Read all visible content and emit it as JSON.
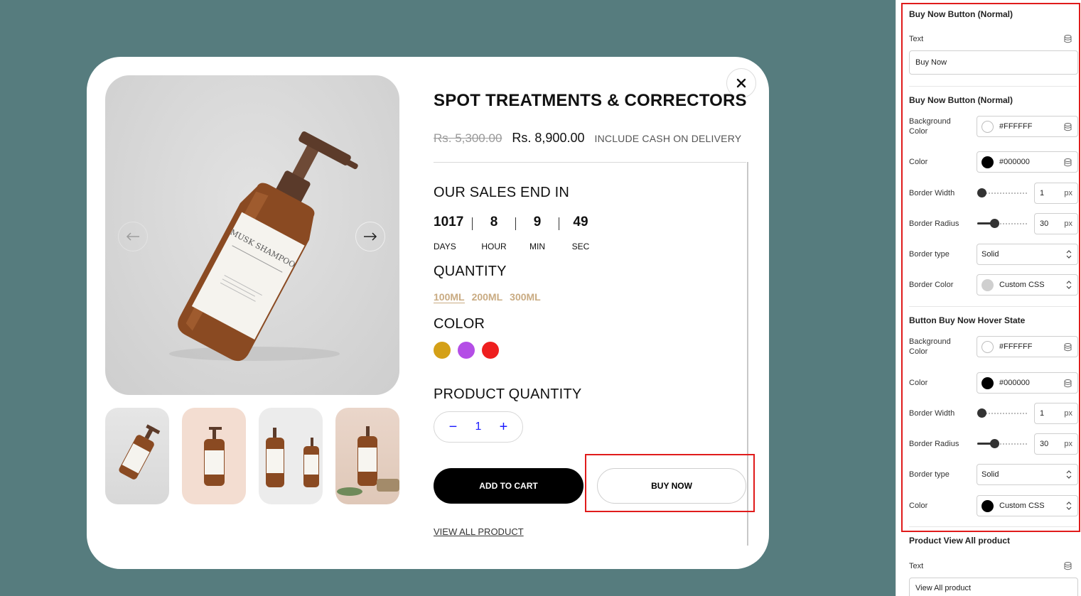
{
  "product": {
    "title": "SPOT TREATMENTS & CORRECTORS",
    "old_price": "Rs. 5,300.00",
    "new_price": "Rs. 8,900.00",
    "cod_note": "INCLUDE CASH ON DELIVERY",
    "image_label": "MUSK SHAMPOO",
    "sales_title": "OUR SALES END IN",
    "countdown": [
      {
        "value": "1017",
        "label": "DAYS"
      },
      {
        "value": "8",
        "label": "HOUR"
      },
      {
        "value": "9",
        "label": "MIN"
      },
      {
        "value": "49",
        "label": "SEC"
      }
    ],
    "quantity_title": "QUANTITY",
    "sizes": [
      "100ML",
      "200ML",
      "300ML"
    ],
    "selected_size": "100ML",
    "color_title": "COLOR",
    "colors": [
      "#d4a017",
      "#b44ee6",
      "#ee1f1f"
    ],
    "product_quantity_title": "PRODUCT QUANTITY",
    "quantity_value": "1",
    "minus_symbol": "−",
    "plus_symbol": "+",
    "add_to_cart_label": "ADD TO CART",
    "buy_now_label": "BUY NOW",
    "view_all_label": "VIEW ALL PRODUCT"
  },
  "panel": {
    "section1_title": "Buy Now Button (Normal)",
    "text_label": "Text",
    "text_value": "Buy Now",
    "section2_title": "Buy Now Button (Normal)",
    "normal": {
      "bg_label_1": "Background",
      "bg_label_2": "Color",
      "bg_value": "#FFFFFF",
      "color_label": "Color",
      "color_value": "#000000",
      "border_width_label": "Border Width",
      "border_width_value": "1",
      "border_radius_label": "Border Radius",
      "border_radius_value": "30",
      "border_type_label": "Border type",
      "border_type_value": "Solid",
      "border_color_label": "Border Color",
      "border_color_value": "Custom CSS",
      "unit": "px"
    },
    "section3_title": "Button Buy Now Hover State",
    "hover": {
      "bg_label_1": "Background",
      "bg_label_2": "Color",
      "bg_value": "#FFFFFF",
      "color_label": "Color",
      "color_value": "#000000",
      "border_width_label": "Border Width",
      "border_width_value": "1",
      "border_radius_label": "Border Radius",
      "border_radius_value": "30",
      "border_type_label": "Border type",
      "border_type_value": "Solid",
      "border_color_label": "Color",
      "border_color_value": "Custom CSS",
      "unit": "px"
    },
    "section4_title": "Product View All product",
    "view_all_text_label": "Text",
    "view_all_text_value": "View All product"
  },
  "colors": {
    "canvas_bg": "#567c7e",
    "highlight": "#e01b1b",
    "size_accent": "#c9ab82",
    "qty_accent": "#1a1aff"
  }
}
